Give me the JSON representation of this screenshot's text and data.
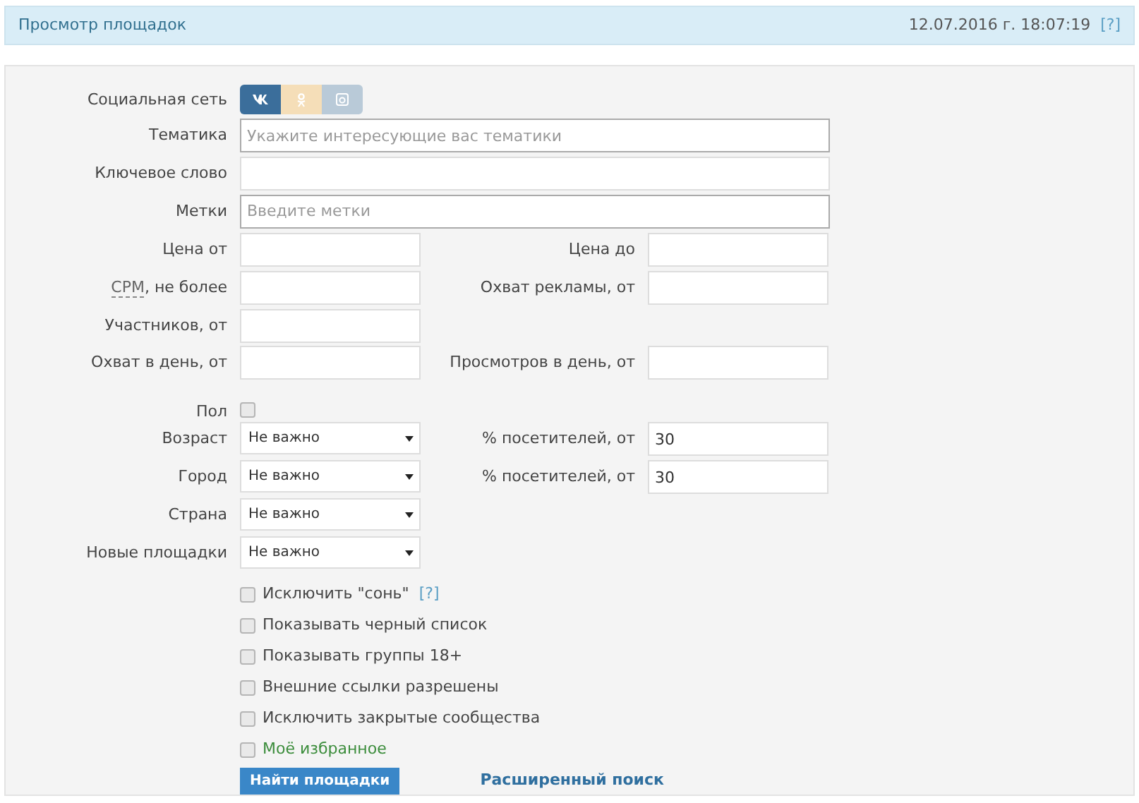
{
  "header": {
    "title": "Просмотр площадок",
    "datetime": "12.07.2016 г. 18:07:19",
    "help": "[?]"
  },
  "social": {
    "label": "Социальная сеть",
    "networks": [
      {
        "kind": "vk",
        "selected": true
      },
      {
        "kind": "ok",
        "selected": false
      },
      {
        "kind": "instagram",
        "selected": false
      }
    ]
  },
  "rows": [
    {
      "kind": "wide",
      "left": {
        "label": "Тематика",
        "kind": "tags",
        "placeholder": "Укажите интересующие вас тематики"
      }
    },
    {
      "kind": "wide",
      "left": {
        "label": "Ключевое слово",
        "kind": "text"
      }
    },
    {
      "kind": "wide",
      "left": {
        "label": "Метки",
        "kind": "tags",
        "placeholder": "Введите метки"
      }
    },
    {
      "kind": "pair",
      "left": {
        "label": "Цена от",
        "kind": "text"
      },
      "right": {
        "label": "Цена до",
        "kind": "text"
      }
    },
    {
      "kind": "pair",
      "left": {
        "abbr": "CPM",
        "label": ", не более",
        "kind": "text"
      },
      "right": {
        "label": "Охват рекламы, от",
        "kind": "text"
      }
    },
    {
      "kind": "pair",
      "left": {
        "label": "Участников, от",
        "kind": "text"
      }
    },
    {
      "kind": "pair",
      "left": {
        "label": "Охват в день, от",
        "kind": "text"
      },
      "right": {
        "label": "Просмотров в день, от",
        "kind": "text"
      }
    },
    {
      "kind": "check",
      "left": {
        "label": "Пол",
        "kind": "checkbox",
        "checked": false
      }
    },
    {
      "kind": "pair",
      "left": {
        "label": "Возраст",
        "kind": "select",
        "value": "Не важно"
      },
      "right": {
        "label": "% посетителей, от",
        "kind": "text",
        "value": "30"
      }
    },
    {
      "kind": "pair",
      "left": {
        "label": "Город",
        "kind": "select",
        "value": "Не важно"
      },
      "right": {
        "label": "% посетителей, от",
        "kind": "text",
        "value": "30"
      }
    },
    {
      "kind": "pair",
      "left": {
        "label": "Страна",
        "kind": "select",
        "value": "Не важно"
      }
    },
    {
      "kind": "pair",
      "left": {
        "label": "Новые площадки",
        "kind": "select",
        "value": "Не важно"
      }
    }
  ],
  "options": [
    {
      "label": "Исключить \"сонь\"",
      "help": "[?]",
      "checked": false,
      "kind": "plain"
    },
    {
      "label": "Показывать черный список",
      "checked": false,
      "kind": "plain"
    },
    {
      "label": "Показывать группы 18+",
      "checked": false,
      "kind": "plain"
    },
    {
      "label": "Внешние ссылки разрешены",
      "checked": false,
      "kind": "plain"
    },
    {
      "label": "Исключить закрытые сообщества",
      "checked": false,
      "kind": "plain"
    },
    {
      "label": "Моё избранное",
      "checked": false,
      "kind": "favorite"
    }
  ],
  "submit": "Найти площадки",
  "advanced_link": "Расширенный поиск"
}
